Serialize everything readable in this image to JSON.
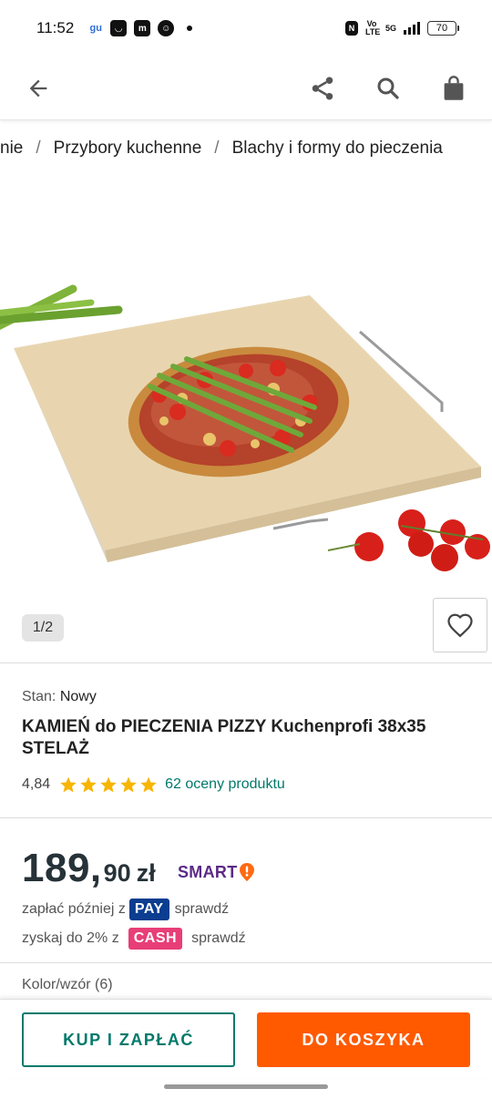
{
  "status_bar": {
    "time": "11:52",
    "network": "5G",
    "volte": "Vo LTE",
    "battery": "70"
  },
  "nav": {
    "back_icon": "arrow-left-icon",
    "share_icon": "share-icon",
    "search_icon": "search-icon",
    "bag_icon": "shopping-bag-icon"
  },
  "breadcrumb": {
    "items": [
      "nie",
      "Przybory kuchenne",
      "Blachy i formy do pieczenia"
    ],
    "separator": "/"
  },
  "gallery": {
    "counter": "1/2"
  },
  "product": {
    "condition_label": "Stan:",
    "condition_value": "Nowy",
    "title": "KAMIEŃ do PIECZENIA PIZZY Kuchenprofi 38x35 STELAŻ",
    "rating_value": "4,84",
    "rating_stars": 5,
    "rating_link": "62 oceny produktu"
  },
  "price": {
    "integer": "189,",
    "fraction": "90",
    "currency": "zł",
    "smart_label": "SMART"
  },
  "payment": {
    "pay_prefix": "zapłać później z",
    "pay_badge": "PAY",
    "pay_link": "sprawdź",
    "cash_prefix": "zyskaj do 2% z",
    "cash_badge": "CASH",
    "cash_link": "sprawdź"
  },
  "variant": {
    "label": "Kolor/wzór (6)"
  },
  "actions": {
    "buy_label": "KUP I ZAPŁAĆ",
    "cart_label": "DO KOSZYKA"
  },
  "colors": {
    "accent_teal": "#00796b",
    "cta_orange": "#ff5a00",
    "star": "#f7b500",
    "smart_purple": "#5b2a86",
    "pay_blue": "#0b3d91",
    "cash_pink": "#e83e78"
  }
}
